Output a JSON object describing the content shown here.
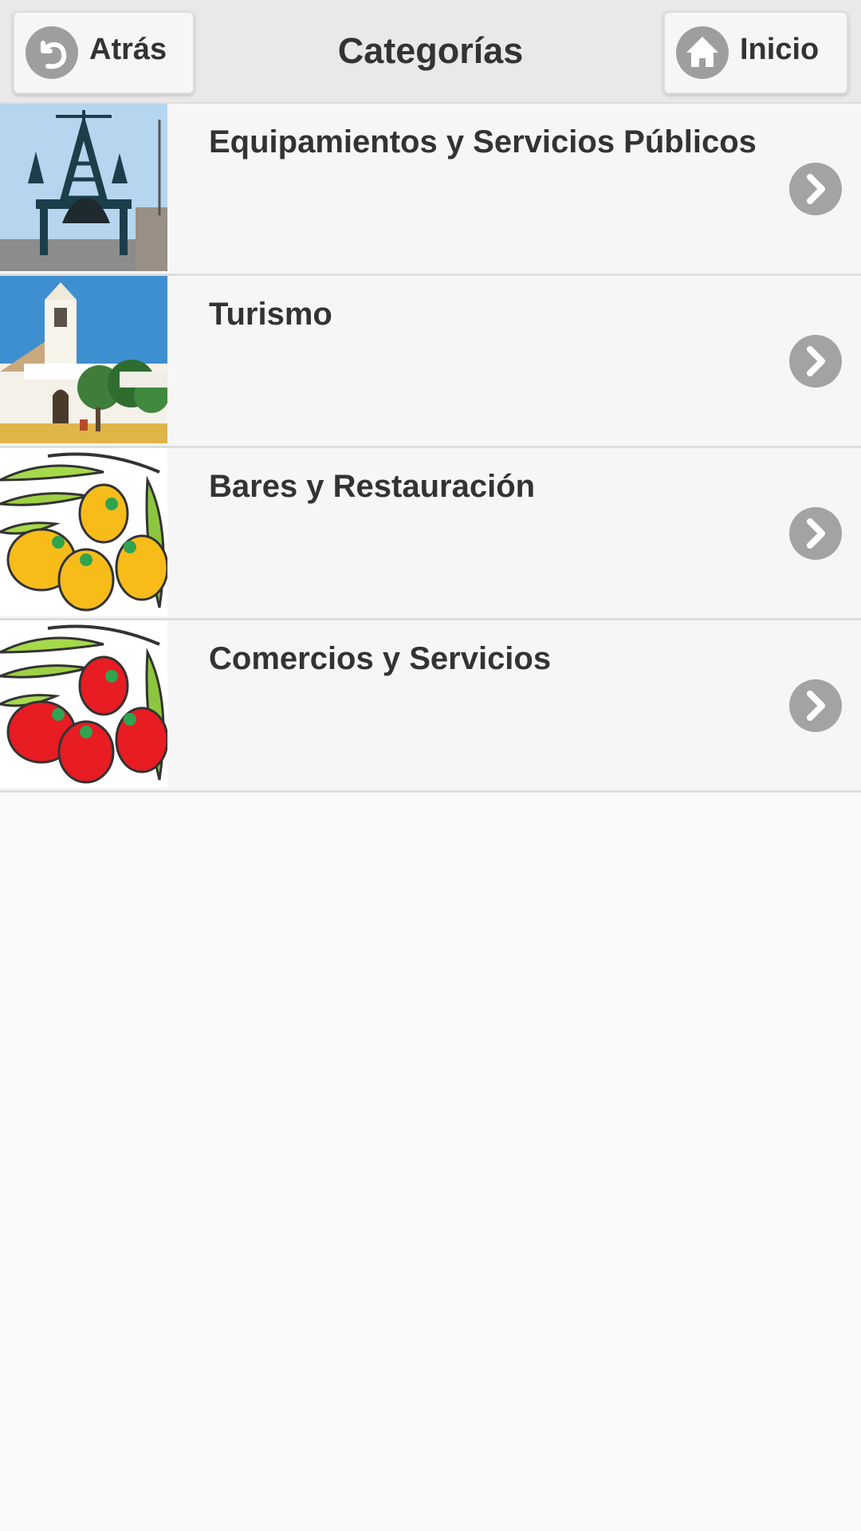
{
  "header": {
    "title": "Categorías",
    "back_label": "Atrás",
    "home_label": "Inicio",
    "back_icon": "undo-arrow-icon",
    "home_icon": "house-icon"
  },
  "categories": [
    {
      "label": "Equipamientos y Servicios Públicos",
      "thumbnail": "bell-tower-photo"
    },
    {
      "label": "Turismo",
      "thumbnail": "church-photo"
    },
    {
      "label": "Bares y Restauración",
      "thumbnail": "yellow-olives-illustration"
    },
    {
      "label": "Comercios y Servicios",
      "thumbnail": "red-olives-illustration"
    }
  ],
  "colors": {
    "header_bg": "#e9e9e9",
    "row_bg": "#f6f6f6",
    "page_bg": "#f9f9f9",
    "icon_gray": "#9e9e9e",
    "text": "#333333"
  }
}
